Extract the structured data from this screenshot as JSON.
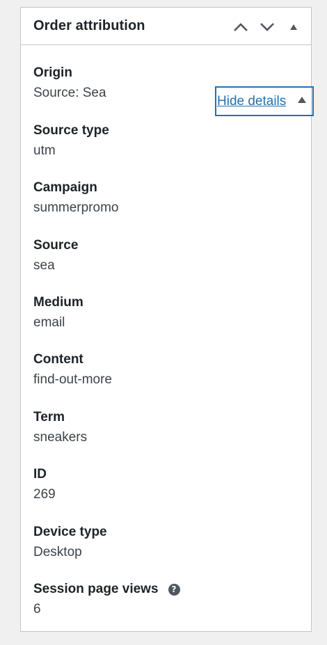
{
  "panel": {
    "title": "Order attribution",
    "controls": {
      "move_up_icon": "chevron-up-icon",
      "move_down_icon": "chevron-down-icon",
      "toggle_icon": "triangle-up-icon"
    }
  },
  "origin": {
    "label": "Origin",
    "value": "Source: Sea",
    "toggle_label": "Hide details"
  },
  "fields": [
    {
      "label": "Source type",
      "value": "utm"
    },
    {
      "label": "Campaign",
      "value": "summerpromo"
    },
    {
      "label": "Source",
      "value": "sea"
    },
    {
      "label": "Medium",
      "value": "email"
    },
    {
      "label": "Content",
      "value": "find-out-more"
    },
    {
      "label": "Term",
      "value": "sneakers"
    },
    {
      "label": "ID",
      "value": "269"
    },
    {
      "label": "Device type",
      "value": "Desktop"
    },
    {
      "label": "Session page views",
      "value": "6",
      "help_icon": "?"
    }
  ],
  "colors": {
    "link": "#2271b1",
    "border": "#c3c4c7",
    "text": "#1d2327"
  }
}
